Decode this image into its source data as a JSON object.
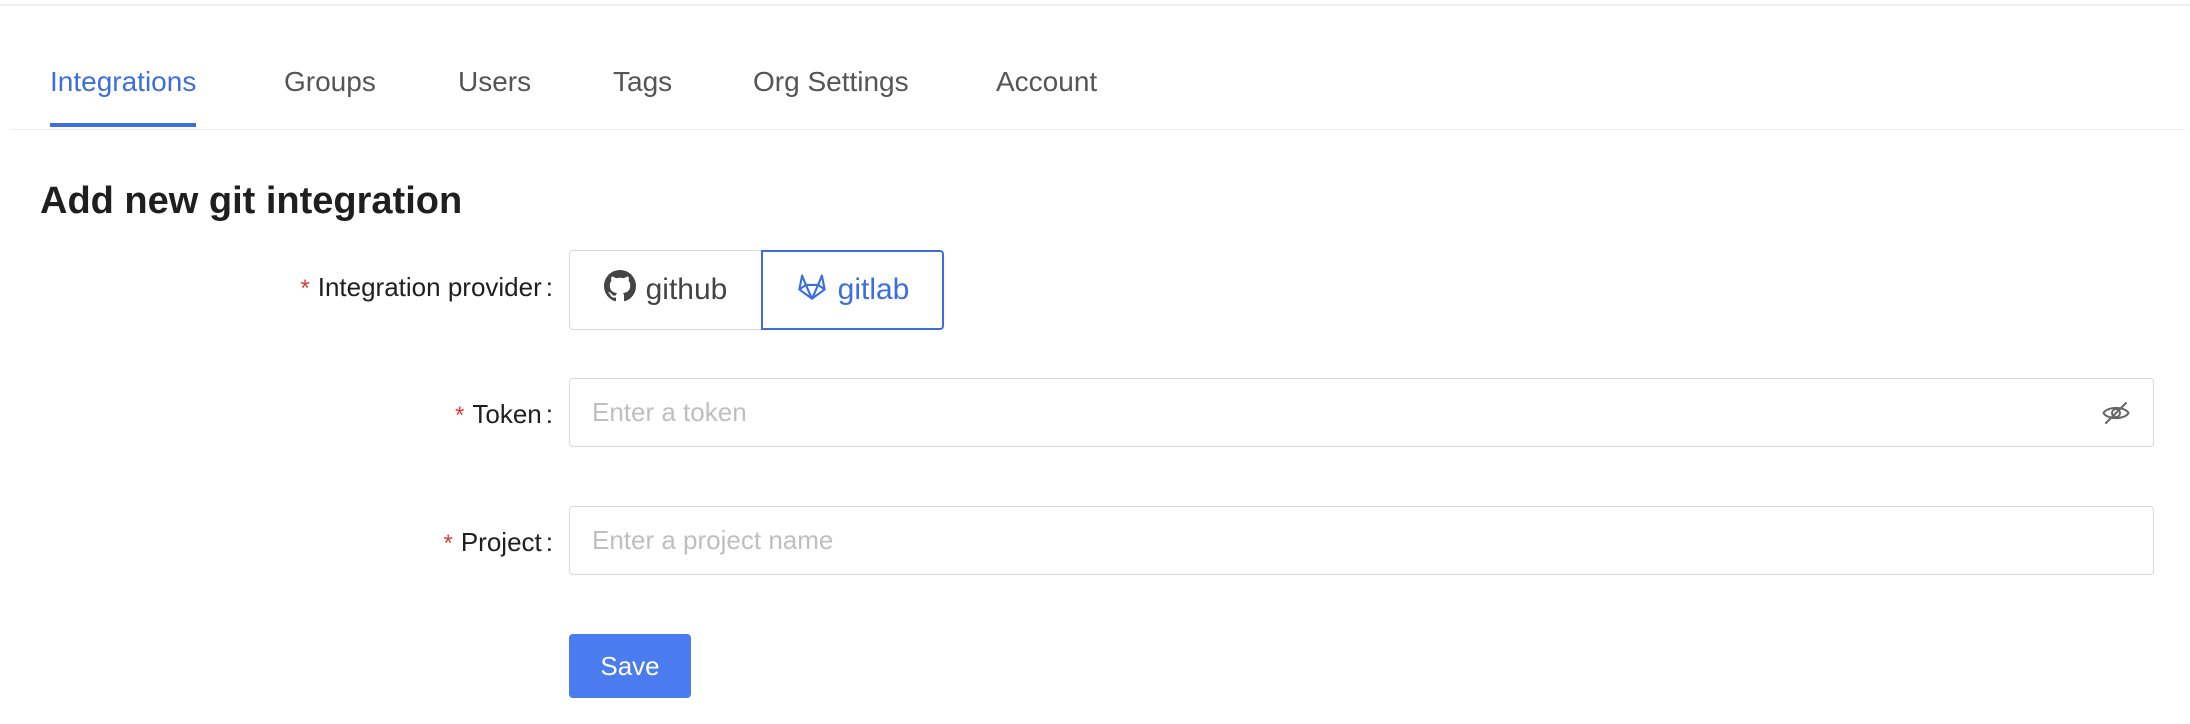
{
  "tabs": [
    {
      "label": "Integrations",
      "active": true
    },
    {
      "label": "Groups",
      "active": false
    },
    {
      "label": "Users",
      "active": false
    },
    {
      "label": "Tags",
      "active": false
    },
    {
      "label": "Org Settings",
      "active": false
    },
    {
      "label": "Account",
      "active": false
    }
  ],
  "page": {
    "title": "Add new git integration"
  },
  "form": {
    "required_mark": "*",
    "colon": ":",
    "provider": {
      "label": "Integration provider",
      "options": [
        {
          "label": "github",
          "icon": "github-icon",
          "selected": false
        },
        {
          "label": "gitlab",
          "icon": "gitlab-icon",
          "selected": true
        }
      ]
    },
    "token": {
      "label": "Token",
      "value": "",
      "placeholder": "Enter a token",
      "toggle_icon": "eye-invisible-icon"
    },
    "project": {
      "label": "Project",
      "value": "",
      "placeholder": "Enter a project name"
    },
    "save_label": "Save"
  },
  "colors": {
    "accent": "#3d6ee0",
    "primary_button": "#4a7bef",
    "required": "#e03a3a",
    "border": "#d9d9d9"
  }
}
